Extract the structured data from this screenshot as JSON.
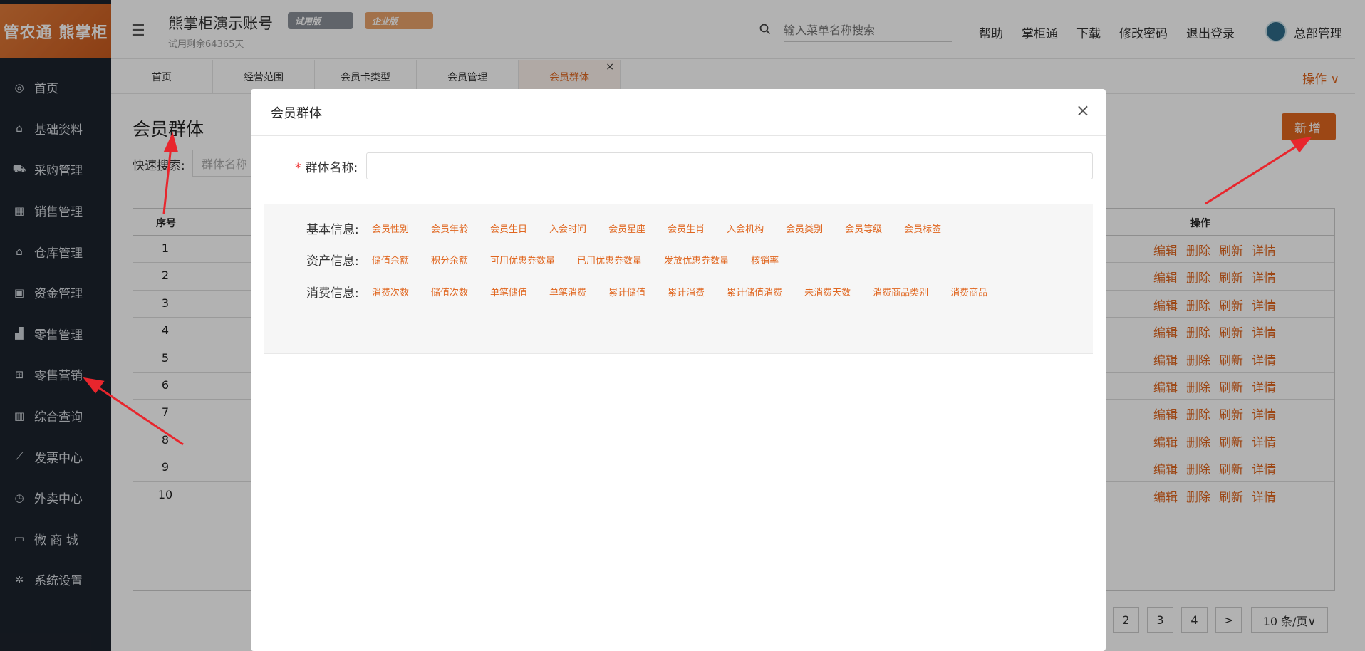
{
  "brand": {
    "logo_text": "管农通 熊掌柜"
  },
  "sidebar": {
    "items": [
      {
        "label": "首页",
        "icon": "globe-icon"
      },
      {
        "label": "基础资料",
        "icon": "home-icon"
      },
      {
        "label": "采购管理",
        "icon": "cart-icon"
      },
      {
        "label": "销售管理",
        "icon": "calendar-icon"
      },
      {
        "label": "仓库管理",
        "icon": "bank-icon"
      },
      {
        "label": "资金管理",
        "icon": "money-icon"
      },
      {
        "label": "零售管理",
        "icon": "area-chart-icon"
      },
      {
        "label": "零售营销",
        "icon": "gift-icon"
      },
      {
        "label": "综合查询",
        "icon": "bar-chart-icon"
      },
      {
        "label": "发票中心",
        "icon": "line-chart-icon"
      },
      {
        "label": "外卖中心",
        "icon": "alarm-icon"
      },
      {
        "label": "微 商 城",
        "icon": "bag-icon"
      },
      {
        "label": "系统设置",
        "icon": "gear-icon"
      }
    ]
  },
  "header": {
    "account_name": "熊掌柜演示账号",
    "trial_remaining": "试用剩余64365天",
    "badge_trial": "试用版",
    "badge_enterprise": "企业版",
    "search_placeholder": "输入菜单名称搜索",
    "links": [
      "帮助",
      "掌柜通",
      "下载",
      "修改密码",
      "退出登录"
    ],
    "user": "总部管理"
  },
  "tabs": {
    "items": [
      "首页",
      "经营范围",
      "会员卡类型",
      "会员管理",
      "会员群体"
    ],
    "close_icon": "×",
    "operations": "操作 ∨"
  },
  "page": {
    "title": "会员群体",
    "quick_search_label": "快速搜索:",
    "quick_search_placeholder": "群体名称",
    "add_button": "新增",
    "table": {
      "col_index": "序号",
      "col_actions": "操作",
      "rows": [
        "1",
        "2",
        "3",
        "4",
        "5",
        "6",
        "7",
        "8",
        "9",
        "10"
      ],
      "actions": [
        "编辑",
        "删除",
        "刷新",
        "详情"
      ]
    },
    "pager": {
      "pages": [
        "2",
        "3",
        "4"
      ],
      "next": ">",
      "page_size": "10 条/页∨"
    }
  },
  "modal": {
    "title": "会员群体",
    "close": "×",
    "field_label": "群体名称:",
    "required_mark": "*",
    "groups": [
      {
        "label": "基本信息:",
        "chips": [
          "会员性别",
          "会员年龄",
          "会员生日",
          "入会时间",
          "会员星座",
          "会员生肖",
          "入会机构",
          "会员类别",
          "会员等级",
          "会员标签"
        ]
      },
      {
        "label": "资产信息:",
        "chips": [
          "储值余额",
          "积分余额",
          "可用优惠券数量",
          "已用优惠券数量",
          "发放优惠券数量",
          "核销率"
        ]
      },
      {
        "label": "消费信息:",
        "chips": [
          "消费次数",
          "储值次数",
          "单笔储值",
          "单笔消费",
          "累计储值",
          "累计消费",
          "累计储值消费",
          "未消费天数",
          "消费商品类别",
          "消费商品"
        ]
      }
    ]
  },
  "colors": {
    "accent": "#e0661f",
    "sidebar_bg": "#1c232d",
    "annotation_arrow": "#e8262d"
  }
}
